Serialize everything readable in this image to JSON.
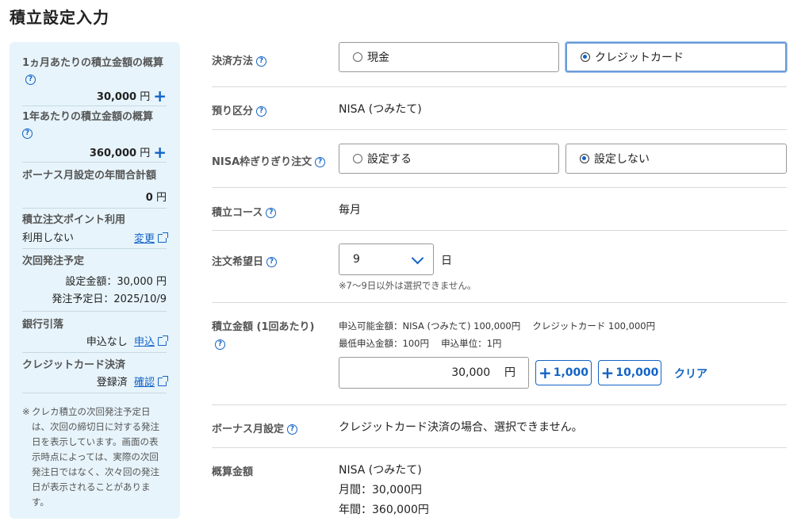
{
  "page_title": "積立設定入力",
  "summary": {
    "monthly_label": "1ヵ月あたりの積立金額の概算",
    "monthly_amount": "30,000",
    "yearly_label": "1年あたりの積立金額の概算",
    "yearly_amount": "360,000",
    "yen": "円",
    "bonus_label": "ボーナス月設定の年間合計額",
    "bonus_amount": "0",
    "points_label": "積立注文ポイント利用",
    "points_value": "利用しない",
    "points_change": "変更",
    "next_label": "次回発注予定",
    "next_amount": "設定金額：30,000 円",
    "next_date": "発注予定日：2025/10/9",
    "bank_label": "銀行引落",
    "bank_value": "申込なし",
    "bank_link": "申込",
    "card_label": "クレジットカード決済",
    "card_value": "登録済",
    "card_link": "確認",
    "note_mark": "※",
    "note": "クレカ積立の次回発注予定日は、次回の締切日に対する発注日を表示しています。画面の表示時点によっては、実際の次回発注日ではなく、次々回の発注日が表示されることがあります。"
  },
  "help_mark": "?",
  "form": {
    "payment": {
      "label": "決済方法",
      "options": [
        "現金",
        "クレジットカード"
      ],
      "selected": "クレジットカード"
    },
    "account": {
      "label": "預り区分",
      "value": "NISA (つみたて)"
    },
    "nisa_limit": {
      "label": "NISA枠ぎりぎり注文",
      "options": [
        "設定する",
        "設定しない"
      ],
      "selected": "設定しない"
    },
    "course": {
      "label": "積立コース",
      "value": "毎月"
    },
    "order_day": {
      "label": "注文希望日",
      "value": "9",
      "unit": "日",
      "note": "※7〜9日以外は選択できません。"
    },
    "amount": {
      "label": "積立金額 (1回あたり)",
      "info1": "申込可能金額：NISA (つみたて) 100,000円　 クレジットカード 100,000円",
      "info2": "最低申込金額：100円　 申込単位：1円",
      "value": "30,000",
      "unit": "円",
      "add1": "1,000",
      "add2": "10,000",
      "clear": "クリア"
    },
    "bonus": {
      "label": "ボーナス月設定",
      "value": "クレジットカード決済の場合、選択できません。"
    },
    "estimate": {
      "label": "概算金額",
      "line1": "NISA (つみたて)",
      "line2": "月間：30,000円",
      "line3": "年間：360,000円"
    }
  }
}
